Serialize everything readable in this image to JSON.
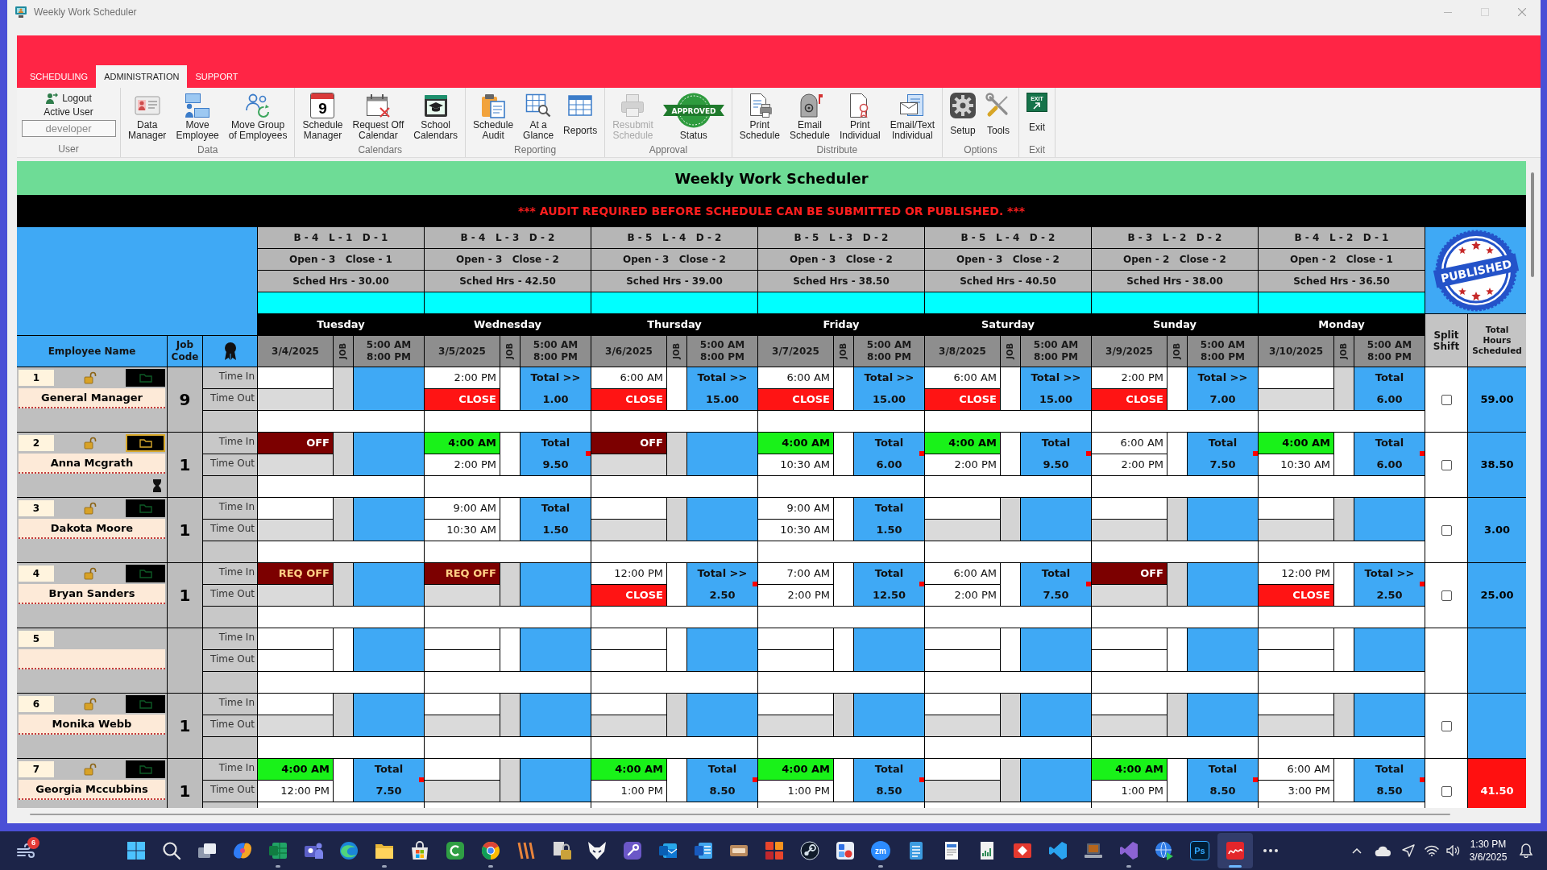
{
  "window": {
    "title": "Weekly Work Scheduler"
  },
  "ribbon": {
    "tabs": [
      {
        "label": "SCHEDULING",
        "selected": false
      },
      {
        "label": "ADMINISTRATION",
        "selected": true
      },
      {
        "label": "SUPPORT",
        "selected": false
      }
    ],
    "user": {
      "logout": "Logout",
      "active_user_label": "Active User",
      "active_user": "developer",
      "label": "User"
    },
    "groups": [
      {
        "label": "Data",
        "buttons": [
          {
            "kind": "data-manager",
            "label": "Data\nManager",
            "disabled": false
          },
          {
            "kind": "move-employee",
            "label": "Move\nEmployee",
            "disabled": false
          },
          {
            "kind": "move-group",
            "label": "Move Group\nof Employees",
            "disabled": false
          }
        ]
      },
      {
        "label": "Calendars",
        "buttons": [
          {
            "kind": "schedule-manager",
            "label": "Schedule\nManager",
            "icon_text": "9",
            "disabled": false
          },
          {
            "kind": "request-off",
            "label": "Request Off\nCalendar",
            "disabled": false
          },
          {
            "kind": "school",
            "label": "School\nCalendars",
            "disabled": false
          }
        ]
      },
      {
        "label": "Reporting",
        "buttons": [
          {
            "kind": "audit",
            "label": "Schedule\nAudit",
            "disabled": false
          },
          {
            "kind": "glance",
            "label": "At a\nGlance",
            "disabled": false
          },
          {
            "kind": "reports",
            "label": "Reports",
            "disabled": false
          }
        ]
      },
      {
        "label": "Approval",
        "buttons": [
          {
            "kind": "resubmit",
            "label": "Resubmit\nSchedule",
            "disabled": true
          },
          {
            "kind": "status",
            "label": "Status",
            "icon_text": "APPROVED",
            "disabled": false
          }
        ]
      },
      {
        "label": "Distribute",
        "buttons": [
          {
            "kind": "print-schedule",
            "label": "Print\nSchedule",
            "disabled": false
          },
          {
            "kind": "email-schedule",
            "label": "Email\nSchedule",
            "disabled": false
          },
          {
            "kind": "print-individual",
            "label": "Print\nIndividual",
            "disabled": false
          },
          {
            "kind": "email-text",
            "label": "Email/Text\nIndividual",
            "disabled": false
          }
        ]
      },
      {
        "label": "Options",
        "buttons": [
          {
            "kind": "setup",
            "label": "Setup",
            "disabled": false
          },
          {
            "kind": "tools",
            "label": "Tools",
            "disabled": false
          }
        ]
      },
      {
        "label": "Exit",
        "buttons": [
          {
            "kind": "exit",
            "label": "Exit",
            "icon_text": "EXIT",
            "disabled": false
          }
        ]
      }
    ]
  },
  "grid": {
    "title": "Weekly Work Scheduler",
    "alert": "*** AUDIT REQUIRED BEFORE SCHEDULE CAN BE SUBMITTED OR PUBLISHED. ***",
    "stamp": "PUBLISHED",
    "header_labels": {
      "employee_name": "Employee Name",
      "job_code": "Job\nCode",
      "split_shift": "Split\nShift",
      "total_hours": "Total\nHours\nScheduled"
    },
    "days": [
      {
        "staffing": "B - 4   L - 1   D - 1",
        "open_close": "Open - 3   Close - 1",
        "sched_hrs": "Sched Hrs - 30.00",
        "name": "Tuesday",
        "date": "3/4/2025",
        "job_label": "JOB",
        "hours_window": "5:00 AM\n8:00 PM"
      },
      {
        "staffing": "B - 4   L - 3   D - 2",
        "open_close": "Open - 3   Close - 2",
        "sched_hrs": "Sched Hrs - 42.50",
        "name": "Wednesday",
        "date": "3/5/2025",
        "job_label": "JOB",
        "hours_window": "5:00 AM\n8:00 PM"
      },
      {
        "staffing": "B - 5   L - 4   D - 2",
        "open_close": "Open - 3   Close - 2",
        "sched_hrs": "Sched Hrs - 39.00",
        "name": "Thursday",
        "date": "3/6/2025",
        "job_label": "JOB",
        "hours_window": "5:00 AM\n8:00 PM"
      },
      {
        "staffing": "B - 5   L - 3   D - 2",
        "open_close": "Open - 3   Close - 2",
        "sched_hrs": "Sched Hrs - 38.50",
        "name": "Friday",
        "date": "3/7/2025",
        "job_label": "JOB",
        "hours_window": "5:00 AM\n8:00 PM"
      },
      {
        "staffing": "B - 5   L - 4   D - 2",
        "open_close": "Open - 3   Close - 2",
        "sched_hrs": "Sched Hrs - 40.50",
        "name": "Saturday",
        "date": "3/8/2025",
        "job_label": "JOB",
        "hours_window": "5:00 AM\n8:00 PM"
      },
      {
        "staffing": "B - 3   L - 2   D - 2",
        "open_close": "Open - 2   Close - 2",
        "sched_hrs": "Sched Hrs - 38.00",
        "name": "Sunday",
        "date": "3/9/2025",
        "job_label": "JOB",
        "hours_window": "5:00 AM\n8:00 PM"
      },
      {
        "staffing": "B - 4   L - 2   D - 1",
        "open_close": "Open - 2   Close - 1",
        "sched_hrs": "Sched Hrs - 36.50",
        "name": "Monday",
        "date": "3/10/2025",
        "job_label": "JOB",
        "hours_window": "5:00 AM\n8:00 PM"
      }
    ],
    "employees": [
      {
        "kind": "employee",
        "number": "1",
        "name": "General Manager",
        "job_code": "9",
        "flag_active": false,
        "waiting": false,
        "time_in_label": "Time In",
        "time_out_label": "Time Out",
        "split_shift": {
          "checked": false
        },
        "total_hours": "59.00",
        "over_hours": false,
        "shifts": [
          {
            "time_in": {
              "kind": "empty"
            },
            "time_out": {
              "kind": "empty"
            },
            "flagged": false
          },
          {
            "time_in": {
              "kind": "time",
              "text": "2:00 PM"
            },
            "time_out": {
              "kind": "close",
              "text": "CLOSE"
            },
            "total": {
              "label": "Total >>",
              "value": "1.00"
            },
            "flagged": false
          },
          {
            "time_in": {
              "kind": "time",
              "text": "6:00 AM"
            },
            "time_out": {
              "kind": "close",
              "text": "CLOSE"
            },
            "total": {
              "label": "Total >>",
              "value": "15.00"
            },
            "flagged": false
          },
          {
            "time_in": {
              "kind": "time",
              "text": "6:00 AM"
            },
            "time_out": {
              "kind": "close",
              "text": "CLOSE"
            },
            "total": {
              "label": "Total >>",
              "value": "15.00"
            },
            "flagged": false
          },
          {
            "time_in": {
              "kind": "time",
              "text": "6:00 AM"
            },
            "time_out": {
              "kind": "close",
              "text": "CLOSE"
            },
            "total": {
              "label": "Total >>",
              "value": "15.00"
            },
            "flagged": false
          },
          {
            "time_in": {
              "kind": "time",
              "text": "2:00 PM"
            },
            "time_out": {
              "kind": "close",
              "text": "CLOSE"
            },
            "total": {
              "label": "Total >>",
              "value": "7.00"
            },
            "flagged": false
          },
          {
            "time_in": {
              "kind": "empty"
            },
            "time_out": {
              "kind": "empty"
            },
            "total": {
              "label": "Total",
              "value": "6.00"
            },
            "flagged": false
          }
        ]
      },
      {
        "kind": "employee",
        "number": "2",
        "name": "Anna Mcgrath",
        "job_code": "1",
        "flag_active": true,
        "waiting": true,
        "time_in_label": "Time In",
        "time_out_label": "Time Out",
        "split_shift": {
          "checked": false
        },
        "total_hours": "38.50",
        "over_hours": false,
        "shifts": [
          {
            "time_in": {
              "kind": "off",
              "text": "OFF"
            },
            "time_out": {
              "kind": "empty"
            },
            "flagged": false
          },
          {
            "time_in": {
              "kind": "highlight",
              "text": "4:00 AM"
            },
            "time_out": {
              "kind": "time",
              "text": "2:00 PM"
            },
            "total": {
              "label": "Total",
              "value": "9.50"
            },
            "flagged": true
          },
          {
            "time_in": {
              "kind": "off",
              "text": "OFF"
            },
            "time_out": {
              "kind": "empty"
            },
            "flagged": false
          },
          {
            "time_in": {
              "kind": "highlight",
              "text": "4:00 AM"
            },
            "time_out": {
              "kind": "time",
              "text": "10:30 AM"
            },
            "total": {
              "label": "Total",
              "value": "6.00"
            },
            "flagged": true
          },
          {
            "time_in": {
              "kind": "highlight",
              "text": "4:00 AM"
            },
            "time_out": {
              "kind": "time",
              "text": "2:00 PM"
            },
            "total": {
              "label": "Total",
              "value": "9.50"
            },
            "flagged": true
          },
          {
            "time_in": {
              "kind": "time",
              "text": "6:00 AM"
            },
            "time_out": {
              "kind": "time",
              "text": "2:00 PM"
            },
            "total": {
              "label": "Total",
              "value": "7.50"
            },
            "flagged": true
          },
          {
            "time_in": {
              "kind": "highlight",
              "text": "4:00 AM"
            },
            "time_out": {
              "kind": "time",
              "text": "10:30 AM"
            },
            "total": {
              "label": "Total",
              "value": "6.00"
            },
            "flagged": true
          }
        ]
      },
      {
        "kind": "employee",
        "number": "3",
        "name": "Dakota Moore",
        "job_code": "1",
        "flag_active": false,
        "waiting": false,
        "time_in_label": "Time In",
        "time_out_label": "Time Out",
        "split_shift": {
          "checked": false
        },
        "total_hours": "3.00",
        "over_hours": false,
        "shifts": [
          {
            "time_in": {
              "kind": "empty"
            },
            "time_out": {
              "kind": "empty"
            },
            "flagged": false
          },
          {
            "time_in": {
              "kind": "time",
              "text": "9:00 AM"
            },
            "time_out": {
              "kind": "time",
              "text": "10:30 AM"
            },
            "total": {
              "label": "Total",
              "value": "1.50"
            },
            "flagged": false
          },
          {
            "time_in": {
              "kind": "empty"
            },
            "time_out": {
              "kind": "empty"
            },
            "flagged": false
          },
          {
            "time_in": {
              "kind": "time",
              "text": "9:00 AM"
            },
            "time_out": {
              "kind": "time",
              "text": "10:30 AM"
            },
            "total": {
              "label": "Total",
              "value": "1.50"
            },
            "flagged": false
          },
          {
            "time_in": {
              "kind": "empty"
            },
            "time_out": {
              "kind": "empty"
            },
            "flagged": false
          },
          {
            "time_in": {
              "kind": "empty"
            },
            "time_out": {
              "kind": "empty"
            },
            "flagged": false
          },
          {
            "time_in": {
              "kind": "empty"
            },
            "time_out": {
              "kind": "empty"
            },
            "flagged": false
          }
        ]
      },
      {
        "kind": "employee",
        "number": "4",
        "name": "Bryan Sanders",
        "job_code": "1",
        "flag_active": false,
        "waiting": false,
        "time_in_label": "Time In",
        "time_out_label": "Time Out",
        "split_shift": {
          "checked": false
        },
        "total_hours": "25.00",
        "over_hours": false,
        "shifts": [
          {
            "time_in": {
              "kind": "request_off",
              "text": "REQ OFF"
            },
            "time_out": {
              "kind": "empty"
            },
            "flagged": false
          },
          {
            "time_in": {
              "kind": "request_off",
              "text": "REQ OFF"
            },
            "time_out": {
              "kind": "empty"
            },
            "flagged": false
          },
          {
            "time_in": {
              "kind": "time",
              "text": "12:00 PM"
            },
            "time_out": {
              "kind": "close",
              "text": "CLOSE"
            },
            "total": {
              "label": "Total >>",
              "value": "2.50"
            },
            "flagged": true
          },
          {
            "time_in": {
              "kind": "time",
              "text": "7:00 AM"
            },
            "time_out": {
              "kind": "time",
              "text": "2:00 PM"
            },
            "total": {
              "label": "Total",
              "value": "12.50"
            },
            "flagged": true
          },
          {
            "time_in": {
              "kind": "time",
              "text": "6:00 AM"
            },
            "time_out": {
              "kind": "time",
              "text": "2:00 PM"
            },
            "total": {
              "label": "Total",
              "value": "7.50"
            },
            "flagged": true
          },
          {
            "time_in": {
              "kind": "off",
              "text": "OFF"
            },
            "time_out": {
              "kind": "empty"
            },
            "flagged": false
          },
          {
            "time_in": {
              "kind": "time",
              "text": "12:00 PM"
            },
            "time_out": {
              "kind": "close",
              "text": "CLOSE"
            },
            "total": {
              "label": "Total >>",
              "value": "2.50"
            },
            "flagged": true
          }
        ]
      },
      {
        "kind": "vacant",
        "number": "5",
        "time_in_label": "Time In",
        "time_out_label": "Time Out",
        "over_hours": false,
        "shifts": [
          {
            "time_in": {
              "kind": "empty"
            },
            "time_out": {
              "kind": "empty"
            },
            "flagged": false
          },
          {
            "time_in": {
              "kind": "empty"
            },
            "time_out": {
              "kind": "empty"
            },
            "flagged": false
          },
          {
            "time_in": {
              "kind": "empty"
            },
            "time_out": {
              "kind": "empty"
            },
            "flagged": false
          },
          {
            "time_in": {
              "kind": "empty"
            },
            "time_out": {
              "kind": "empty"
            },
            "flagged": false
          },
          {
            "time_in": {
              "kind": "empty"
            },
            "time_out": {
              "kind": "empty"
            },
            "flagged": false
          },
          {
            "time_in": {
              "kind": "empty"
            },
            "time_out": {
              "kind": "empty"
            },
            "flagged": false
          },
          {
            "time_in": {
              "kind": "empty"
            },
            "time_out": {
              "kind": "empty"
            },
            "flagged": false
          }
        ]
      },
      {
        "kind": "employee",
        "number": "6",
        "name": "Monika Webb",
        "job_code": "1",
        "flag_active": false,
        "waiting": false,
        "time_in_label": "Time In",
        "time_out_label": "Time Out",
        "split_shift": {
          "checked": false
        },
        "over_hours": false,
        "shifts": [
          {
            "time_in": {
              "kind": "empty"
            },
            "time_out": {
              "kind": "empty"
            },
            "flagged": false
          },
          {
            "time_in": {
              "kind": "empty"
            },
            "time_out": {
              "kind": "empty"
            },
            "flagged": false
          },
          {
            "time_in": {
              "kind": "empty"
            },
            "time_out": {
              "kind": "empty"
            },
            "flagged": false
          },
          {
            "time_in": {
              "kind": "empty"
            },
            "time_out": {
              "kind": "empty"
            },
            "flagged": false
          },
          {
            "time_in": {
              "kind": "empty"
            },
            "time_out": {
              "kind": "empty"
            },
            "flagged": false
          },
          {
            "time_in": {
              "kind": "empty"
            },
            "time_out": {
              "kind": "empty"
            },
            "flagged": false
          },
          {
            "time_in": {
              "kind": "empty"
            },
            "time_out": {
              "kind": "empty"
            },
            "flagged": false
          }
        ]
      },
      {
        "kind": "employee",
        "number": "7",
        "name": "Georgia Mccubbins",
        "job_code": "1",
        "flag_active": false,
        "waiting": false,
        "time_in_label": "Time In",
        "time_out_label": "Time Out",
        "split_shift": {
          "checked": false
        },
        "total_hours": "41.50",
        "over_hours": true,
        "shifts": [
          {
            "time_in": {
              "kind": "highlight",
              "text": "4:00 AM"
            },
            "time_out": {
              "kind": "time",
              "text": "12:00 PM"
            },
            "total": {
              "label": "Total",
              "value": "7.50"
            },
            "flagged": true
          },
          {
            "time_in": {
              "kind": "empty"
            },
            "time_out": {
              "kind": "empty"
            },
            "flagged": false
          },
          {
            "time_in": {
              "kind": "highlight",
              "text": "4:00 AM"
            },
            "time_out": {
              "kind": "time",
              "text": "1:00 PM"
            },
            "total": {
              "label": "Total",
              "value": "8.50"
            },
            "flagged": true
          },
          {
            "time_in": {
              "kind": "highlight",
              "text": "4:00 AM"
            },
            "time_out": {
              "kind": "time",
              "text": "1:00 PM"
            },
            "total": {
              "label": "Total",
              "value": "8.50"
            },
            "flagged": true
          },
          {
            "time_in": {
              "kind": "empty"
            },
            "time_out": {
              "kind": "empty"
            },
            "flagged": false
          },
          {
            "time_in": {
              "kind": "highlight",
              "text": "4:00 AM"
            },
            "time_out": {
              "kind": "time",
              "text": "1:00 PM"
            },
            "total": {
              "label": "Total",
              "value": "8.50"
            },
            "flagged": true
          },
          {
            "time_in": {
              "kind": "time",
              "text": "6:00 AM"
            },
            "time_out": {
              "kind": "time",
              "text": "3:00 PM"
            },
            "total": {
              "label": "Total",
              "value": "8.50"
            },
            "flagged": true
          }
        ]
      }
    ]
  },
  "taskbar": {
    "widgets": {
      "badge": "6"
    },
    "apps": [
      {
        "kind": "start",
        "running": false,
        "active": false
      },
      {
        "kind": "search",
        "running": false,
        "active": false
      },
      {
        "kind": "task-view",
        "running": false,
        "active": false
      },
      {
        "kind": "swirl",
        "running": false,
        "active": false
      },
      {
        "kind": "spreadsheet",
        "running": true,
        "active": false
      },
      {
        "kind": "people",
        "running": false,
        "active": false
      },
      {
        "kind": "wave-browser",
        "running": false,
        "active": false
      },
      {
        "kind": "folder",
        "running": true,
        "active": false
      },
      {
        "kind": "store",
        "running": false,
        "active": false
      },
      {
        "kind": "arc-tile",
        "running": false,
        "active": false
      },
      {
        "kind": "segmented-circle",
        "running": true,
        "active": false
      },
      {
        "kind": "stripes",
        "running": false,
        "active": false
      },
      {
        "kind": "padlock",
        "running": false,
        "active": false
      },
      {
        "kind": "mask",
        "running": false,
        "active": false
      },
      {
        "kind": "wrench-tile",
        "running": false,
        "active": false
      },
      {
        "kind": "mail-tile",
        "running": false,
        "active": false
      },
      {
        "kind": "document-tile",
        "running": false,
        "active": false
      },
      {
        "kind": "label",
        "running": false,
        "active": false
      },
      {
        "kind": "tiles",
        "running": false,
        "active": false
      },
      {
        "kind": "linked-circles",
        "running": false,
        "active": false
      },
      {
        "kind": "shapes",
        "running": false,
        "active": false
      },
      {
        "kind": "lettered-circle",
        "label": "zm",
        "running": true,
        "active": false
      },
      {
        "kind": "notepad",
        "running": false,
        "active": false
      },
      {
        "kind": "document",
        "running": false,
        "active": false
      },
      {
        "kind": "chart-document",
        "running": false,
        "active": false
      },
      {
        "kind": "diamond-tile",
        "running": false,
        "active": false
      },
      {
        "kind": "folded-ribbon",
        "running": false,
        "active": false
      },
      {
        "kind": "laptop",
        "running": false,
        "active": false
      },
      {
        "kind": "loop-ribbon",
        "running": true,
        "active": false
      },
      {
        "kind": "globe-arrow",
        "running": false,
        "active": false
      },
      {
        "kind": "lettered-square",
        "label": "Ps",
        "running": false,
        "active": false
      },
      {
        "kind": "signature-tile",
        "running": true,
        "active": true
      },
      {
        "kind": "more",
        "running": false,
        "active": false
      }
    ],
    "clock": {
      "time": "1:30 PM",
      "date": "3/6/2025"
    }
  }
}
